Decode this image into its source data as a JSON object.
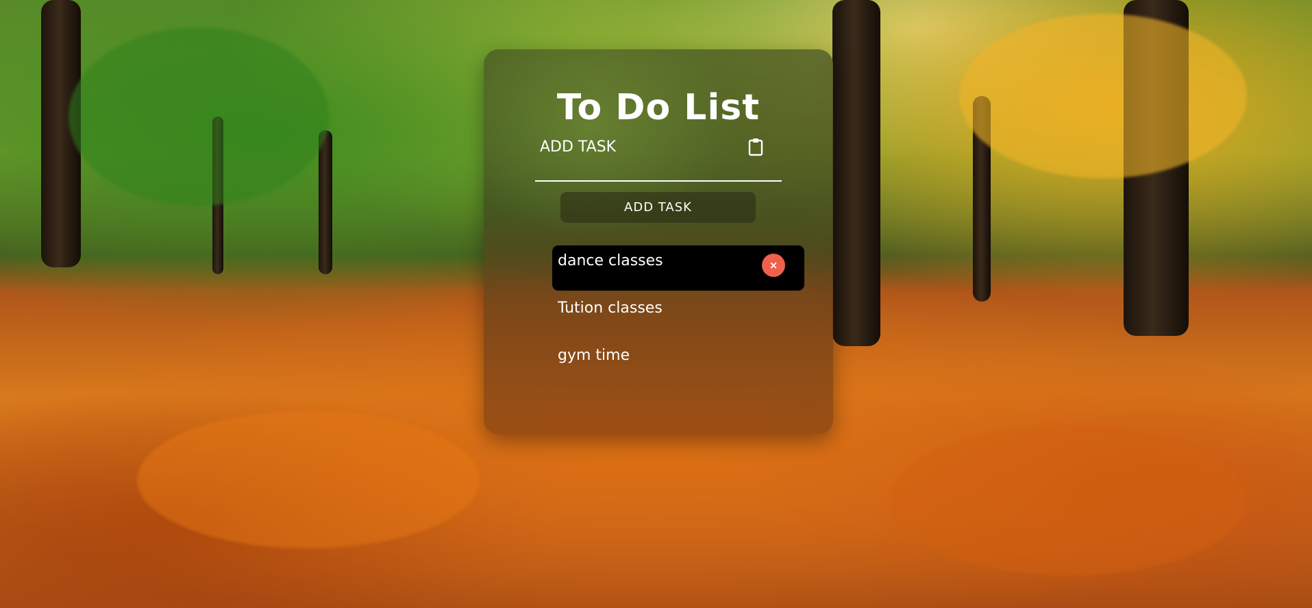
{
  "app": {
    "title": "To Do List"
  },
  "input": {
    "placeholder": "ADD TASK",
    "icon": "clipboard-icon"
  },
  "add_button": {
    "label": "ADD TASK"
  },
  "tasks": [
    {
      "text": "dance classes",
      "highlighted": true,
      "delete_label": "×"
    },
    {
      "text": "Tution classes",
      "highlighted": false
    },
    {
      "text": "gym time",
      "highlighted": false
    }
  ],
  "colors": {
    "delete_button": "#f0604c",
    "highlight_row": "#000000",
    "text": "#ffffff"
  },
  "background": {
    "description": "autumn-forest-photo"
  }
}
